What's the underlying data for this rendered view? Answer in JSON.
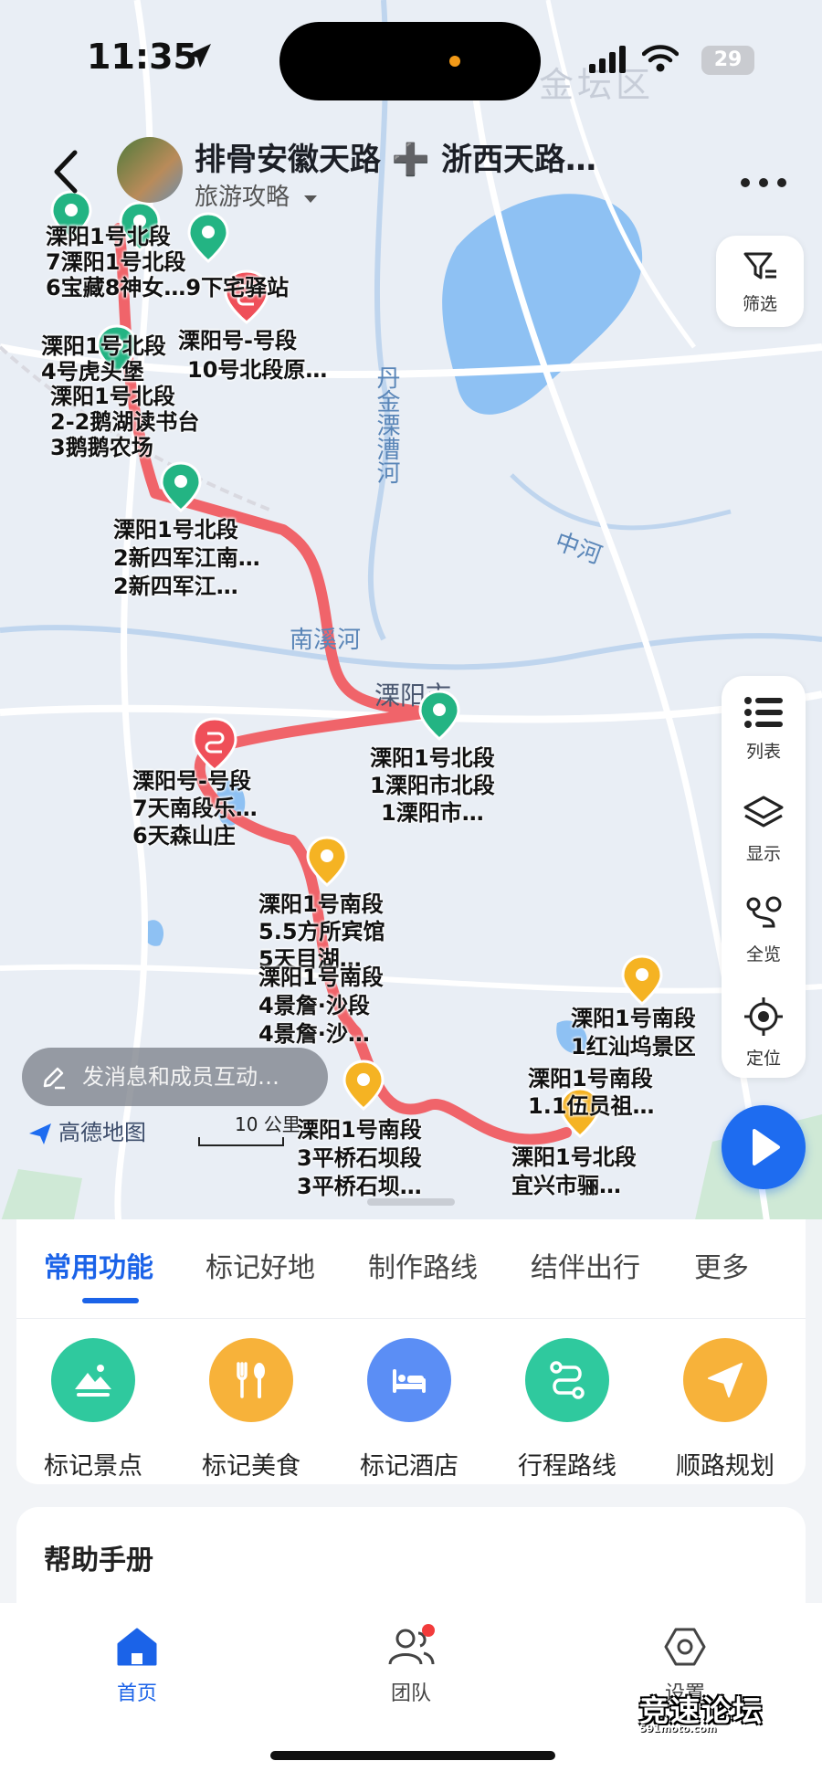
{
  "status_bar": {
    "time": "11:35",
    "battery": "29"
  },
  "map": {
    "district_label": "金坛区",
    "city_label": "溧阳市",
    "water_labels": [
      "丹金溧漕河",
      "中河",
      "南溪河"
    ],
    "markers": [
      {
        "lines": [
          "溧阳1号北段",
          "7溧阳1号北段",
          "6宝藏8神女…9下宅驿站"
        ],
        "color": "green"
      },
      {
        "lines": [
          "溧阳1号北段",
          "4号虎头堡"
        ],
        "color": "green"
      },
      {
        "lines": [
          "溧阳1号北段",
          "2-2鹅湖读书台",
          "3鹅鹅农场"
        ],
        "color": "green"
      },
      {
        "lines": [
          "溧阳号-号段",
          "10号北段原…"
        ],
        "color": "red"
      },
      {
        "lines": [
          "溧阳1号北段",
          "2新四军江南…",
          "2新四军江…"
        ],
        "color": "green"
      },
      {
        "lines": [
          "溧阳1号北段",
          "1溧阳市北段",
          "1溧阳市…"
        ],
        "color": "green"
      },
      {
        "lines": [
          "溧阳号-号段",
          "7天南段乐…",
          "6天森山庄"
        ],
        "color": "red"
      },
      {
        "lines": [
          "溧阳1号南段",
          "5.5方所宾馆",
          "5天目湖…"
        ],
        "color": "orange"
      },
      {
        "lines": [
          "溧阳1号南段",
          "4景詹·沙段",
          "4景詹·沙…"
        ],
        "color": "orange"
      },
      {
        "lines": [
          "溧阳1号南段",
          "3平桥石坝段",
          "3平桥石坝…"
        ],
        "color": "orange"
      },
      {
        "lines": [
          "溧阳1号南段",
          "1红汕坞景区"
        ],
        "color": "orange"
      },
      {
        "lines": [
          "溧阳1号南段",
          "1.1伍员祖…"
        ],
        "color": "orange"
      },
      {
        "lines": [
          "溧阳1号北段",
          "宜兴市骊…"
        ],
        "color": "orange"
      }
    ],
    "message_placeholder": "发消息和成员互动…",
    "map_provider": "高德地图",
    "scale_label": "10 公里"
  },
  "header": {
    "title": "排骨安徽天路 ➕ 浙西天路…",
    "subtitle": "旅游攻略"
  },
  "side_controls": {
    "filter": "筛选",
    "list": "列表",
    "display": "显示",
    "overview": "全览",
    "locate": "定位"
  },
  "sheet": {
    "tabs": [
      "常用功能",
      "标记好地",
      "制作路线",
      "结伴出行",
      "更多"
    ],
    "active_tab": "常用功能",
    "functions": [
      {
        "label": "标记景点",
        "icon": "landscape-icon",
        "color": "#2fc99e"
      },
      {
        "label": "标记美食",
        "icon": "cutlery-icon",
        "color": "#f7b23a"
      },
      {
        "label": "标记酒店",
        "icon": "bed-icon",
        "color": "#5b8ef5"
      },
      {
        "label": "行程路线",
        "icon": "route-icon",
        "color": "#2fc99e"
      },
      {
        "label": "顺路规划",
        "icon": "navigate-icon",
        "color": "#f7b23a"
      }
    ],
    "help_title": "帮助手册"
  },
  "tabbar": {
    "items": [
      {
        "label": "首页",
        "icon": "home-icon",
        "active": true
      },
      {
        "label": "团队",
        "icon": "team-icon",
        "active": false
      },
      {
        "label": "设置",
        "icon": "settings-icon",
        "active": false
      }
    ]
  },
  "watermark": {
    "text": "竞速论坛",
    "sub": "591moto.com"
  },
  "colors": {
    "accent": "#1b63e8",
    "route": "#f0646a",
    "green_pin": "#23b483",
    "orange_pin": "#f5b323",
    "red_pin": "#ef4f59"
  }
}
